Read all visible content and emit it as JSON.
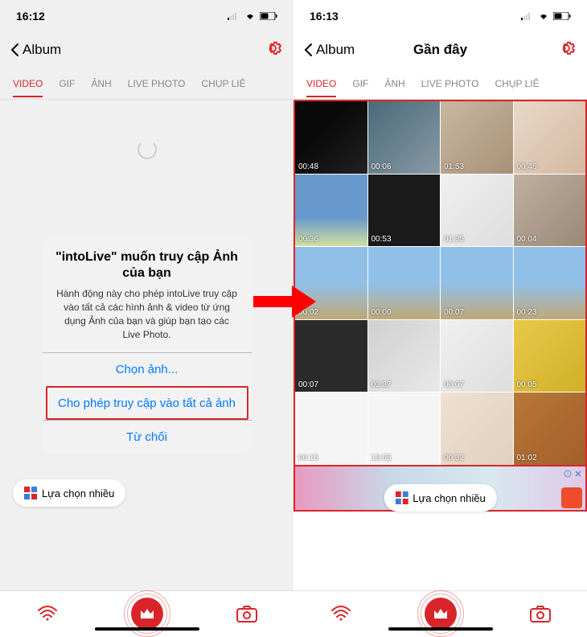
{
  "left": {
    "status_time": "16:12",
    "nav_back": "Album",
    "tabs": [
      "VIDEO",
      "GIF",
      "ẢNH",
      "LIVE PHOTO",
      "CHỤP LIÊ"
    ],
    "dialog": {
      "title": "\"intoLive\" muốn truy cập Ảnh của bạn",
      "body": "Hành động này cho phép intoLive truy cập vào tất cả các hình ảnh & video từ ứng dụng Ảnh của bạn và giúp bạn tạo các Live Photo.",
      "btn_select": "Chọn ảnh...",
      "btn_allow": "Cho phép truy cập vào tất cả ảnh",
      "btn_deny": "Từ chối"
    },
    "multi_select": "Lựa chọn nhiều"
  },
  "right": {
    "status_time": "16:13",
    "nav_back": "Album",
    "nav_title": "Gần đây",
    "tabs": [
      "VIDEO",
      "GIF",
      "ẢNH",
      "LIVE PHOTO",
      "CHỤP LIÊ"
    ],
    "videos": [
      {
        "d": "00:48"
      },
      {
        "d": "00:06"
      },
      {
        "d": "01:53"
      },
      {
        "d": "00:46"
      },
      {
        "d": "00:36"
      },
      {
        "d": "00:53"
      },
      {
        "d": "01:35"
      },
      {
        "d": "00:04"
      },
      {
        "d": "00:02"
      },
      {
        "d": "00:00"
      },
      {
        "d": "00:07"
      },
      {
        "d": "00:23"
      },
      {
        "d": "00:07"
      },
      {
        "d": "03:37"
      },
      {
        "d": "00:07"
      },
      {
        "d": "00:05"
      },
      {
        "d": "00:15"
      },
      {
        "d": "13:05"
      },
      {
        "d": "00:32"
      },
      {
        "d": "01:02"
      }
    ],
    "multi_select": "Lựa chọn nhiều"
  },
  "thumb_classes": [
    "bg1",
    "bg2",
    "bg3",
    "bg4",
    "bg5",
    "bg6",
    "bg7",
    "bg8",
    "bg9",
    "bg9",
    "bg9",
    "bg9",
    "bg10",
    "bg11",
    "bg7",
    "bg12",
    "bg14",
    "bg14",
    "bg13",
    "bg15"
  ]
}
